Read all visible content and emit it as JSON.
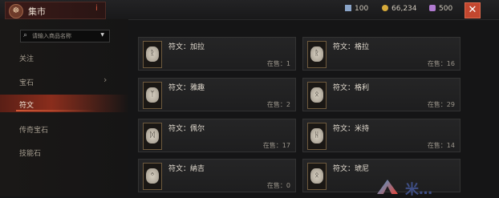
{
  "header": {
    "title": "集市",
    "title_mark": "i",
    "close_label": "✕"
  },
  "currencies": [
    {
      "icon": "silver-bar-icon",
      "value": "100",
      "color": "#8aa4c8"
    },
    {
      "icon": "gold-coin-icon",
      "value": "66,234",
      "color": "#d6aa3a"
    },
    {
      "icon": "platinum-icon",
      "value": "500",
      "color": "#b07ad0"
    }
  ],
  "search": {
    "placeholder": "请输入商品名称"
  },
  "nav": [
    {
      "label": "关注",
      "active": false
    },
    {
      "label": "宝石",
      "active": false
    },
    {
      "label": "符文",
      "active": true
    },
    {
      "label": "传奇宝石",
      "active": false
    },
    {
      "label": "技能石",
      "active": false
    }
  ],
  "items": [
    {
      "name": "符文：加拉",
      "stock": "在售：1",
      "glyph": "ᚱ"
    },
    {
      "name": "符文：格拉",
      "stock": "在售：16",
      "glyph": "ᚱ"
    },
    {
      "name": "符文：雅趣",
      "stock": "在售：2",
      "glyph": "ᛉ"
    },
    {
      "name": "符文：格利",
      "stock": "在售：29",
      "glyph": "ᛟ"
    },
    {
      "name": "符文：佩尔",
      "stock": "在售：17",
      "glyph": "ᛞ"
    },
    {
      "name": "符文：米持",
      "stock": "在售：14",
      "glyph": "ᚺ"
    },
    {
      "name": "符文：納吉",
      "stock": "在售：0",
      "glyph": "ᛜ"
    },
    {
      "name": "符文：琥尼",
      "stock": "",
      "glyph": "ᛟ"
    }
  ],
  "watermark": "米…"
}
